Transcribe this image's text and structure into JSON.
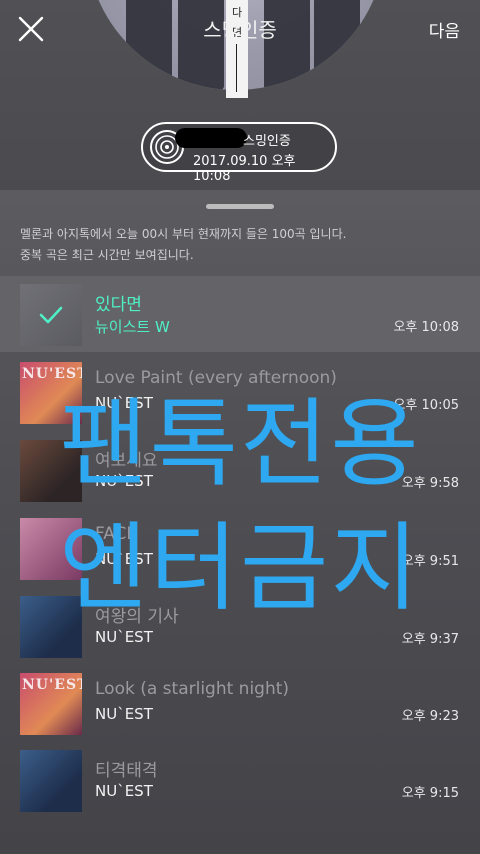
{
  "header": {
    "title": "스밍인증",
    "next_label": "다음",
    "close_icon": "close-icon",
    "album_stripe": [
      "다",
      "면"
    ]
  },
  "badge": {
    "label": "스밍인증",
    "datetime": "2017.09.10 오후 10:08",
    "icon": "disc-icon"
  },
  "notice": {
    "line1": "멜론과 아지톡에서 오늘 00시 부터 현재까지 들은 100곡 입니다.",
    "line2": "중복 곡은 최근 시간만 보여집니다."
  },
  "songs": [
    {
      "title": "있다면",
      "artist": "뉴이스트 W",
      "time": "오후 10:08",
      "selected": true,
      "thumb_tag": ""
    },
    {
      "title": "Love Paint (every afternoon)",
      "artist": "NU`EST",
      "time": "오후 10:05",
      "selected": false,
      "thumb_tag": "NU'EST"
    },
    {
      "title": "여보세요",
      "artist": "NU`EST",
      "time": "오후 9:58",
      "selected": false,
      "thumb_tag": ""
    },
    {
      "title": "FACE",
      "artist": "NU`EST",
      "time": "오후 9:51",
      "selected": false,
      "thumb_tag": ""
    },
    {
      "title": "여왕의 기사",
      "artist": "NU`EST",
      "time": "오후 9:37",
      "selected": false,
      "thumb_tag": ""
    },
    {
      "title": "Look (a starlight night)",
      "artist": "NU`EST",
      "time": "오후 9:23",
      "selected": false,
      "thumb_tag": "NU'EST"
    },
    {
      "title": "티격태격",
      "artist": "NU`EST",
      "time": "오후 9:15",
      "selected": false,
      "thumb_tag": ""
    }
  ],
  "watermark": {
    "line1": "팬톡전용",
    "line2": "엔터금지",
    "color": "#2ea8f0"
  },
  "colors": {
    "accent": "#4ff0c6"
  }
}
